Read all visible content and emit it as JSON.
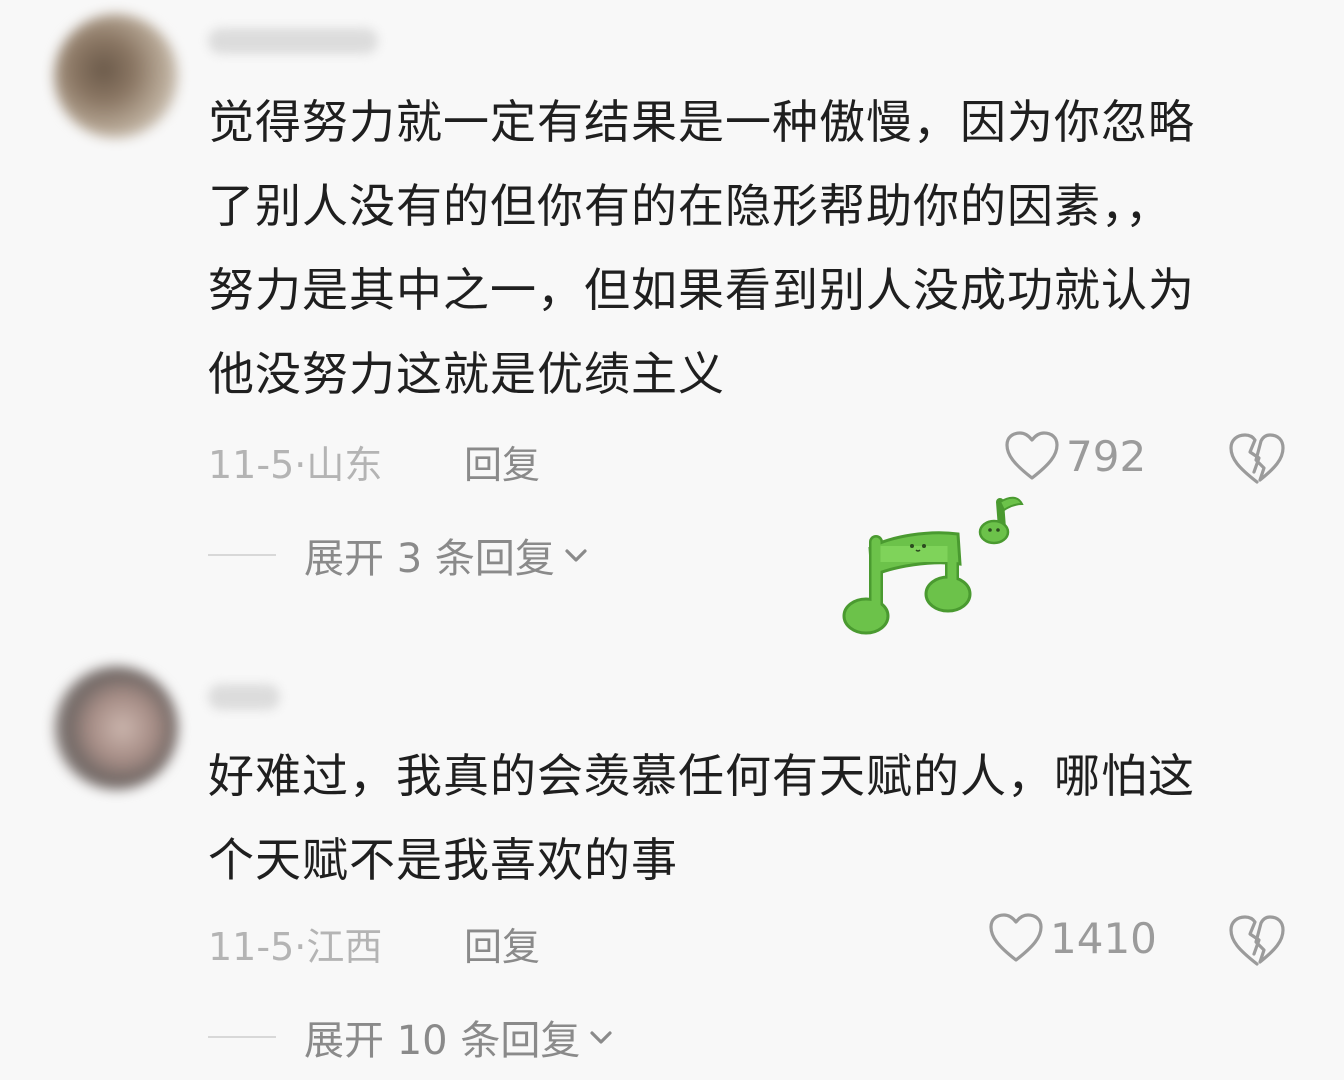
{
  "comments": [
    {
      "text_lines": [
        "觉得努力就一定有结果是一种傲慢，因为你忽略",
        "了别人没有的但你有的在隐形帮助你的因素，，",
        "努力是其中之一，但如果看到别人没成功就认为",
        "他没努力这就是优绩主义"
      ],
      "meta": "11-5·山东",
      "reply_label": "回复",
      "like_count": "792",
      "expand_label": "展开 3 条回复"
    },
    {
      "text_lines": [
        "好难过，我真的会羡慕任何有天赋的人，哪怕这",
        "个天赋不是我喜欢的事"
      ],
      "meta": "11-5·江西",
      "reply_label": "回复",
      "like_count": "1410",
      "expand_label": "展开 10 条回复"
    }
  ],
  "colors": {
    "text": "#1f1f1f",
    "meta": "#b4b4b4",
    "secondary": "#8a8a8a",
    "sticker_green": "#6cc24a"
  },
  "icons": {
    "like": "heart-icon",
    "dislike": "broken-heart-icon",
    "expand": "chevron-down-icon",
    "sticker": "music-notes-sticker"
  }
}
